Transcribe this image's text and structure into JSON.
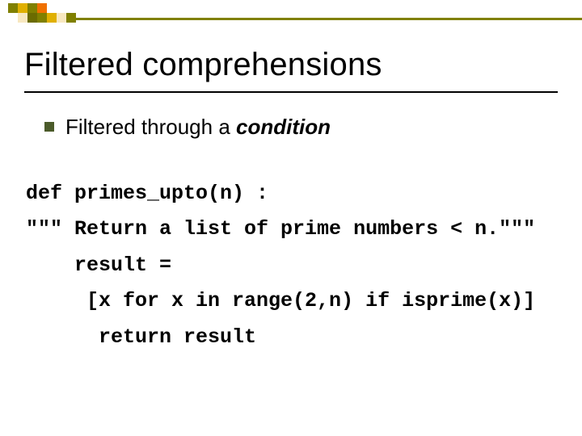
{
  "title": "Filtered comprehensions",
  "bullet": {
    "prefix": "Filtered through a ",
    "emph": "condition"
  },
  "code": {
    "l1": "def primes_upto(n) :",
    "l2": "\"\"\" Return a list of prime numbers < n.\"\"\"",
    "l3": "    result =",
    "l4": "     [x for x in range(2,n) if isprime(x)]",
    "l5": "      return result"
  },
  "deco": {
    "colors": {
      "olive": "#808000",
      "olive_dark": "#6b6b00",
      "gold": "#e0b000",
      "orange": "#f07000",
      "cream": "#f8e8c0",
      "line": "#808000"
    }
  }
}
